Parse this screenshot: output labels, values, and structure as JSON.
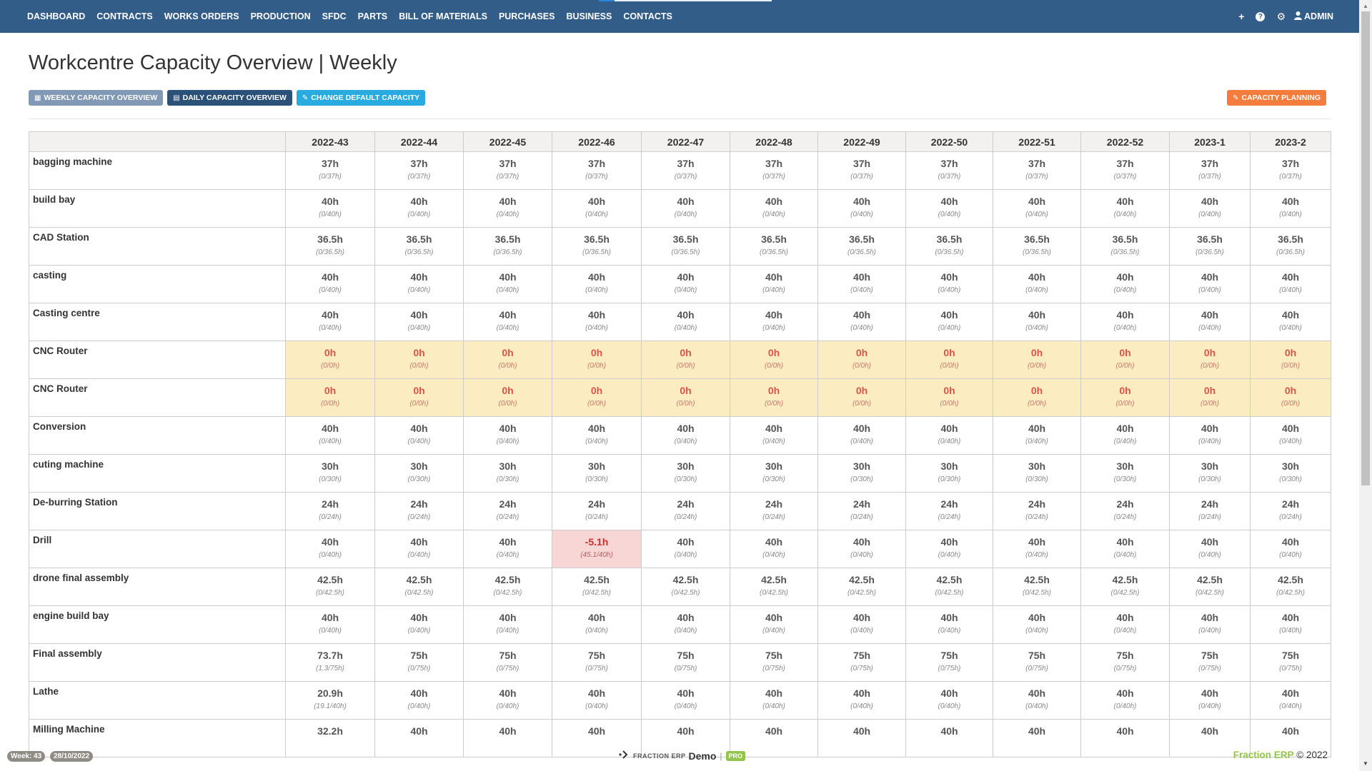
{
  "nav": {
    "items": [
      "DASHBOARD",
      "CONTRACTS",
      "WORKS ORDERS",
      "PRODUCTION",
      "SFDC",
      "PARTS",
      "BILL OF MATERIALS",
      "PURCHASES",
      "BUSINESS",
      "CONTACTS"
    ],
    "icons": {
      "add": "+",
      "help": "?",
      "settings": "⚙",
      "user": "👤"
    },
    "admin_label": "ADMIN"
  },
  "page": {
    "title": "Workcentre Capacity Overview | Weekly"
  },
  "buttons": {
    "weekly": "WEEKLY CAPACITY OVERVIEW",
    "daily": "DAILY CAPACITY OVERVIEW",
    "change": "CHANGE DEFAULT CAPACITY",
    "planning": "CAPACITY PLANNING"
  },
  "table": {
    "weeks": [
      "2022-43",
      "2022-44",
      "2022-45",
      "2022-46",
      "2022-47",
      "2022-48",
      "2022-49",
      "2022-50",
      "2022-51",
      "2022-52",
      "2023-1",
      "2023-2"
    ],
    "rows": [
      {
        "name": "bagging machine",
        "cells": [
          [
            "37h",
            "(0/37h)"
          ],
          [
            "37h",
            "(0/37h)"
          ],
          [
            "37h",
            "(0/37h)"
          ],
          [
            "37h",
            "(0/37h)"
          ],
          [
            "37h",
            "(0/37h)"
          ],
          [
            "37h",
            "(0/37h)"
          ],
          [
            "37h",
            "(0/37h)"
          ],
          [
            "37h",
            "(0/37h)"
          ],
          [
            "37h",
            "(0/37h)"
          ],
          [
            "37h",
            "(0/37h)"
          ],
          [
            "37h",
            "(0/37h)"
          ],
          [
            "37h",
            "(0/37h)"
          ]
        ]
      },
      {
        "name": "build bay",
        "cells": [
          [
            "40h",
            "(0/40h)"
          ],
          [
            "40h",
            "(0/40h)"
          ],
          [
            "40h",
            "(0/40h)"
          ],
          [
            "40h",
            "(0/40h)"
          ],
          [
            "40h",
            "(0/40h)"
          ],
          [
            "40h",
            "(0/40h)"
          ],
          [
            "40h",
            "(0/40h)"
          ],
          [
            "40h",
            "(0/40h)"
          ],
          [
            "40h",
            "(0/40h)"
          ],
          [
            "40h",
            "(0/40h)"
          ],
          [
            "40h",
            "(0/40h)"
          ],
          [
            "40h",
            "(0/40h)"
          ]
        ]
      },
      {
        "name": "CAD Station",
        "cells": [
          [
            "36.5h",
            "(0/36.5h)"
          ],
          [
            "36.5h",
            "(0/36.5h)"
          ],
          [
            "36.5h",
            "(0/36.5h)"
          ],
          [
            "36.5h",
            "(0/36.5h)"
          ],
          [
            "36.5h",
            "(0/36.5h)"
          ],
          [
            "36.5h",
            "(0/36.5h)"
          ],
          [
            "36.5h",
            "(0/36.5h)"
          ],
          [
            "36.5h",
            "(0/36.5h)"
          ],
          [
            "36.5h",
            "(0/36.5h)"
          ],
          [
            "36.5h",
            "(0/36.5h)"
          ],
          [
            "36.5h",
            "(0/36.5h)"
          ],
          [
            "36.5h",
            "(0/36.5h)"
          ]
        ]
      },
      {
        "name": "casting",
        "cells": [
          [
            "40h",
            "(0/40h)"
          ],
          [
            "40h",
            "(0/40h)"
          ],
          [
            "40h",
            "(0/40h)"
          ],
          [
            "40h",
            "(0/40h)"
          ],
          [
            "40h",
            "(0/40h)"
          ],
          [
            "40h",
            "(0/40h)"
          ],
          [
            "40h",
            "(0/40h)"
          ],
          [
            "40h",
            "(0/40h)"
          ],
          [
            "40h",
            "(0/40h)"
          ],
          [
            "40h",
            "(0/40h)"
          ],
          [
            "40h",
            "(0/40h)"
          ],
          [
            "40h",
            "(0/40h)"
          ]
        ]
      },
      {
        "name": "Casting centre",
        "cells": [
          [
            "40h",
            "(0/40h)"
          ],
          [
            "40h",
            "(0/40h)"
          ],
          [
            "40h",
            "(0/40h)"
          ],
          [
            "40h",
            "(0/40h)"
          ],
          [
            "40h",
            "(0/40h)"
          ],
          [
            "40h",
            "(0/40h)"
          ],
          [
            "40h",
            "(0/40h)"
          ],
          [
            "40h",
            "(0/40h)"
          ],
          [
            "40h",
            "(0/40h)"
          ],
          [
            "40h",
            "(0/40h)"
          ],
          [
            "40h",
            "(0/40h)"
          ],
          [
            "40h",
            "(0/40h)"
          ]
        ]
      },
      {
        "name": "CNC Router",
        "status": "warn",
        "cells": [
          [
            "0h",
            "(0/0h)"
          ],
          [
            "0h",
            "(0/0h)"
          ],
          [
            "0h",
            "(0/0h)"
          ],
          [
            "0h",
            "(0/0h)"
          ],
          [
            "0h",
            "(0/0h)"
          ],
          [
            "0h",
            "(0/0h)"
          ],
          [
            "0h",
            "(0/0h)"
          ],
          [
            "0h",
            "(0/0h)"
          ],
          [
            "0h",
            "(0/0h)"
          ],
          [
            "0h",
            "(0/0h)"
          ],
          [
            "0h",
            "(0/0h)"
          ],
          [
            "0h",
            "(0/0h)"
          ]
        ]
      },
      {
        "name": "CNC Router",
        "status": "warn",
        "cells": [
          [
            "0h",
            "(0/0h)"
          ],
          [
            "0h",
            "(0/0h)"
          ],
          [
            "0h",
            "(0/0h)"
          ],
          [
            "0h",
            "(0/0h)"
          ],
          [
            "0h",
            "(0/0h)"
          ],
          [
            "0h",
            "(0/0h)"
          ],
          [
            "0h",
            "(0/0h)"
          ],
          [
            "0h",
            "(0/0h)"
          ],
          [
            "0h",
            "(0/0h)"
          ],
          [
            "0h",
            "(0/0h)"
          ],
          [
            "0h",
            "(0/0h)"
          ],
          [
            "0h",
            "(0/0h)"
          ]
        ]
      },
      {
        "name": "Conversion",
        "cells": [
          [
            "40h",
            "(0/40h)"
          ],
          [
            "40h",
            "(0/40h)"
          ],
          [
            "40h",
            "(0/40h)"
          ],
          [
            "40h",
            "(0/40h)"
          ],
          [
            "40h",
            "(0/40h)"
          ],
          [
            "40h",
            "(0/40h)"
          ],
          [
            "40h",
            "(0/40h)"
          ],
          [
            "40h",
            "(0/40h)"
          ],
          [
            "40h",
            "(0/40h)"
          ],
          [
            "40h",
            "(0/40h)"
          ],
          [
            "40h",
            "(0/40h)"
          ],
          [
            "40h",
            "(0/40h)"
          ]
        ]
      },
      {
        "name": "cuting machine",
        "cells": [
          [
            "30h",
            "(0/30h)"
          ],
          [
            "30h",
            "(0/30h)"
          ],
          [
            "30h",
            "(0/30h)"
          ],
          [
            "30h",
            "(0/30h)"
          ],
          [
            "30h",
            "(0/30h)"
          ],
          [
            "30h",
            "(0/30h)"
          ],
          [
            "30h",
            "(0/30h)"
          ],
          [
            "30h",
            "(0/30h)"
          ],
          [
            "30h",
            "(0/30h)"
          ],
          [
            "30h",
            "(0/30h)"
          ],
          [
            "30h",
            "(0/30h)"
          ],
          [
            "30h",
            "(0/30h)"
          ]
        ]
      },
      {
        "name": "De-burring Station",
        "cells": [
          [
            "24h",
            "(0/24h)"
          ],
          [
            "24h",
            "(0/24h)"
          ],
          [
            "24h",
            "(0/24h)"
          ],
          [
            "24h",
            "(0/24h)"
          ],
          [
            "24h",
            "(0/24h)"
          ],
          [
            "24h",
            "(0/24h)"
          ],
          [
            "24h",
            "(0/24h)"
          ],
          [
            "24h",
            "(0/24h)"
          ],
          [
            "24h",
            "(0/24h)"
          ],
          [
            "24h",
            "(0/24h)"
          ],
          [
            "24h",
            "(0/24h)"
          ],
          [
            "24h",
            "(0/24h)"
          ]
        ]
      },
      {
        "name": "Drill",
        "cells": [
          [
            "40h",
            "(0/40h)"
          ],
          [
            "40h",
            "(0/40h)"
          ],
          [
            "40h",
            "(0/40h)"
          ],
          [
            "-5.1h",
            "(45.1/40h)",
            "over"
          ],
          [
            "40h",
            "(0/40h)"
          ],
          [
            "40h",
            "(0/40h)"
          ],
          [
            "40h",
            "(0/40h)"
          ],
          [
            "40h",
            "(0/40h)"
          ],
          [
            "40h",
            "(0/40h)"
          ],
          [
            "40h",
            "(0/40h)"
          ],
          [
            "40h",
            "(0/40h)"
          ],
          [
            "40h",
            "(0/40h)"
          ]
        ]
      },
      {
        "name": "drone final assembly",
        "cells": [
          [
            "42.5h",
            "(0/42.5h)"
          ],
          [
            "42.5h",
            "(0/42.5h)"
          ],
          [
            "42.5h",
            "(0/42.5h)"
          ],
          [
            "42.5h",
            "(0/42.5h)"
          ],
          [
            "42.5h",
            "(0/42.5h)"
          ],
          [
            "42.5h",
            "(0/42.5h)"
          ],
          [
            "42.5h",
            "(0/42.5h)"
          ],
          [
            "42.5h",
            "(0/42.5h)"
          ],
          [
            "42.5h",
            "(0/42.5h)"
          ],
          [
            "42.5h",
            "(0/42.5h)"
          ],
          [
            "42.5h",
            "(0/42.5h)"
          ],
          [
            "42.5h",
            "(0/42.5h)"
          ]
        ]
      },
      {
        "name": "engine build bay",
        "cells": [
          [
            "40h",
            "(0/40h)"
          ],
          [
            "40h",
            "(0/40h)"
          ],
          [
            "40h",
            "(0/40h)"
          ],
          [
            "40h",
            "(0/40h)"
          ],
          [
            "40h",
            "(0/40h)"
          ],
          [
            "40h",
            "(0/40h)"
          ],
          [
            "40h",
            "(0/40h)"
          ],
          [
            "40h",
            "(0/40h)"
          ],
          [
            "40h",
            "(0/40h)"
          ],
          [
            "40h",
            "(0/40h)"
          ],
          [
            "40h",
            "(0/40h)"
          ],
          [
            "40h",
            "(0/40h)"
          ]
        ]
      },
      {
        "name": "Final assembly",
        "cells": [
          [
            "73.7h",
            "(1.3/75h)"
          ],
          [
            "75h",
            "(0/75h)"
          ],
          [
            "75h",
            "(0/75h)"
          ],
          [
            "75h",
            "(0/75h)"
          ],
          [
            "75h",
            "(0/75h)"
          ],
          [
            "75h",
            "(0/75h)"
          ],
          [
            "75h",
            "(0/75h)"
          ],
          [
            "75h",
            "(0/75h)"
          ],
          [
            "75h",
            "(0/75h)"
          ],
          [
            "75h",
            "(0/75h)"
          ],
          [
            "75h",
            "(0/75h)"
          ],
          [
            "75h",
            "(0/75h)"
          ]
        ]
      },
      {
        "name": "Lathe",
        "cells": [
          [
            "20.9h",
            "(19.1/40h)"
          ],
          [
            "40h",
            "(0/40h)"
          ],
          [
            "40h",
            "(0/40h)"
          ],
          [
            "40h",
            "(0/40h)"
          ],
          [
            "40h",
            "(0/40h)"
          ],
          [
            "40h",
            "(0/40h)"
          ],
          [
            "40h",
            "(0/40h)"
          ],
          [
            "40h",
            "(0/40h)"
          ],
          [
            "40h",
            "(0/40h)"
          ],
          [
            "40h",
            "(0/40h)"
          ],
          [
            "40h",
            "(0/40h)"
          ],
          [
            "40h",
            "(0/40h)"
          ]
        ]
      },
      {
        "name": "Milling Machine",
        "cells": [
          [
            "32.2h",
            ""
          ],
          [
            "40h",
            ""
          ],
          [
            "40h",
            ""
          ],
          [
            "40h",
            ""
          ],
          [
            "40h",
            ""
          ],
          [
            "40h",
            ""
          ],
          [
            "40h",
            ""
          ],
          [
            "40h",
            ""
          ],
          [
            "40h",
            ""
          ],
          [
            "40h",
            ""
          ],
          [
            "40h",
            ""
          ],
          [
            "40h",
            ""
          ]
        ]
      }
    ]
  },
  "footer": {
    "week_badge": "Week: 43",
    "date_badge": "28/10/2022",
    "brand_small": "FRACTION ERP",
    "brand_demo": "Demo",
    "separator": "|",
    "pro_badge": "PRO",
    "copyright_brand": "Fraction ERP",
    "copyright_rest": "© 2022"
  }
}
